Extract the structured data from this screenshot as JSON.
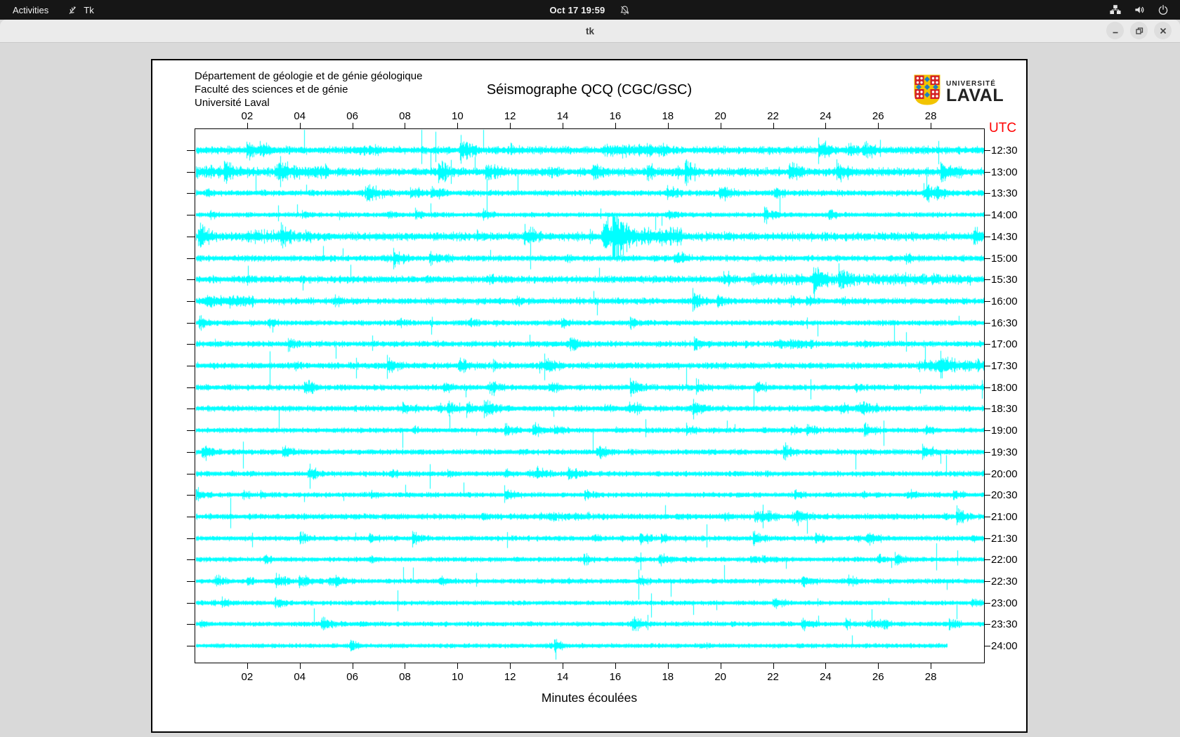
{
  "topbar": {
    "activities": "Activities",
    "app_name": "Tk",
    "clock": "Oct 17 19:59",
    "icons": {
      "app": "tk-feather-icon",
      "notifications": "bell-slash-icon",
      "tray": [
        "network-icon",
        "volume-icon",
        "power-icon"
      ]
    }
  },
  "window": {
    "title": "tk"
  },
  "canvas_header": {
    "dept_line1": "Département de géologie et de génie géologique",
    "dept_line2": "Faculté des sciences et de génie",
    "dept_line3": "Université Laval",
    "title": "Séismographe QCQ (CGC/GSC)"
  },
  "logo": {
    "line1": "UNIVERSITÉ",
    "line2": "LAVAL"
  },
  "chart_data": {
    "type": "line",
    "subtype": "helicorder-seismogram",
    "title": "Séismographe QCQ (CGC/GSC)",
    "xlabel": "Minutes écoulées",
    "right_axis_title": "UTC",
    "x_range": [
      0,
      30
    ],
    "x_ticks": [
      2,
      4,
      6,
      8,
      10,
      12,
      14,
      16,
      18,
      20,
      22,
      24,
      26,
      28
    ],
    "x_tick_labels": [
      "02",
      "04",
      "06",
      "08",
      "10",
      "12",
      "14",
      "16",
      "18",
      "20",
      "22",
      "24",
      "26",
      "28"
    ],
    "grid": false,
    "trace_color": "#00ffff",
    "utc_label_color": "#ff0000",
    "axis_color": "#000000",
    "note": "24 half-hour seismogram traces of broadband noise with impulsive spikes; values are unlabeled noise, reproduced procedurally",
    "series": [
      {
        "label": "12:30",
        "activity": 1.35,
        "seed": 13,
        "end_minute": 30,
        "bursts": [
          {
            "s": 15.5,
            "e": 18,
            "m": 2.0
          },
          {
            "s": 6,
            "e": 7,
            "m": 1.6
          }
        ]
      },
      {
        "label": "13:00",
        "activity": 1.45,
        "seed": 110,
        "end_minute": 30,
        "bursts": [
          {
            "s": 0,
            "e": 2,
            "m": 1.6
          },
          {
            "s": 3,
            "e": 5,
            "m": 1.8
          }
        ]
      },
      {
        "label": "13:30",
        "activity": 1.0,
        "seed": 207,
        "end_minute": 30,
        "bursts": [
          {
            "s": 6.5,
            "e": 7.5,
            "m": 1.7
          }
        ]
      },
      {
        "label": "14:00",
        "activity": 0.75,
        "seed": 304,
        "end_minute": 30,
        "bursts": []
      },
      {
        "label": "14:30",
        "activity": 1.5,
        "seed": 401,
        "end_minute": 30,
        "bursts": [
          {
            "s": 15.5,
            "e": 18.5,
            "m": 2.6
          },
          {
            "s": 2,
            "e": 4,
            "m": 1.5
          }
        ]
      },
      {
        "label": "15:00",
        "activity": 1.0,
        "seed": 498,
        "end_minute": 30,
        "bursts": []
      },
      {
        "label": "15:30",
        "activity": 1.25,
        "seed": 595,
        "end_minute": 30,
        "bursts": [
          {
            "s": 21,
            "e": 29.5,
            "m": 1.7
          }
        ]
      },
      {
        "label": "16:00",
        "activity": 1.1,
        "seed": 692,
        "end_minute": 30,
        "bursts": [
          {
            "s": 0.3,
            "e": 2.2,
            "m": 2.2
          }
        ]
      },
      {
        "label": "16:30",
        "activity": 0.85,
        "seed": 789,
        "end_minute": 30,
        "bursts": []
      },
      {
        "label": "17:00",
        "activity": 1.0,
        "seed": 886,
        "end_minute": 30,
        "bursts": [
          {
            "s": 22,
            "e": 23.5,
            "m": 1.8
          }
        ]
      },
      {
        "label": "17:30",
        "activity": 1.1,
        "seed": 983,
        "end_minute": 30,
        "bursts": [
          {
            "s": 27.5,
            "e": 30,
            "m": 2.2
          }
        ]
      },
      {
        "label": "18:00",
        "activity": 0.95,
        "seed": 1080,
        "end_minute": 30,
        "bursts": []
      },
      {
        "label": "18:30",
        "activity": 1.0,
        "seed": 1177,
        "end_minute": 30,
        "bursts": [
          {
            "s": 24.5,
            "e": 26,
            "m": 1.8
          }
        ]
      },
      {
        "label": "19:00",
        "activity": 0.8,
        "seed": 1274,
        "end_minute": 30,
        "bursts": []
      },
      {
        "label": "19:30",
        "activity": 0.9,
        "seed": 1371,
        "end_minute": 30,
        "bursts": []
      },
      {
        "label": "20:00",
        "activity": 0.85,
        "seed": 1468,
        "end_minute": 30,
        "bursts": []
      },
      {
        "label": "20:30",
        "activity": 0.8,
        "seed": 1565,
        "end_minute": 30,
        "bursts": []
      },
      {
        "label": "21:00",
        "activity": 0.95,
        "seed": 1662,
        "end_minute": 30,
        "bursts": [
          {
            "s": 13,
            "e": 15,
            "m": 1.5
          }
        ]
      },
      {
        "label": "21:30",
        "activity": 0.8,
        "seed": 1759,
        "end_minute": 30,
        "bursts": []
      },
      {
        "label": "22:00",
        "activity": 0.75,
        "seed": 1856,
        "end_minute": 30,
        "bursts": []
      },
      {
        "label": "22:30",
        "activity": 0.8,
        "seed": 1953,
        "end_minute": 30,
        "bursts": []
      },
      {
        "label": "23:00",
        "activity": 0.7,
        "seed": 2050,
        "end_minute": 30,
        "bursts": []
      },
      {
        "label": "23:30",
        "activity": 0.75,
        "seed": 2147,
        "end_minute": 30,
        "bursts": [
          {
            "s": 25.5,
            "e": 26.5,
            "m": 2.0
          }
        ]
      },
      {
        "label": "24:00",
        "activity": 0.7,
        "seed": 2244,
        "end_minute": 28.6,
        "bursts": [
          {
            "s": 13,
            "e": 14,
            "m": 1.5
          }
        ]
      }
    ]
  }
}
